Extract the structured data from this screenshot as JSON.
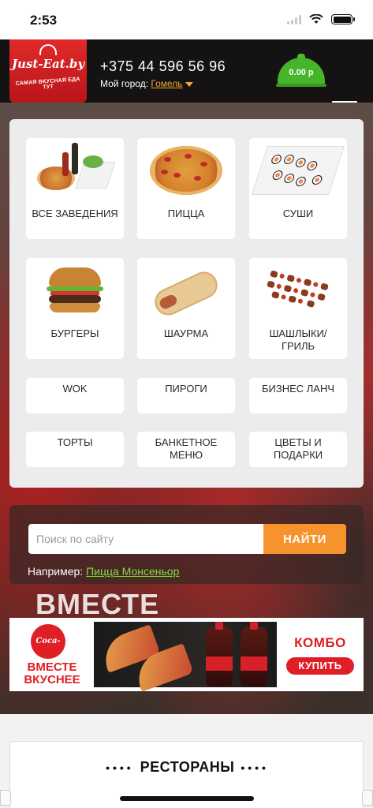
{
  "status_bar": {
    "time": "2:53"
  },
  "header": {
    "logo_name": "Just-Eat.by",
    "logo_tagline": "САМАЯ ВКУСНАЯ ЕДА ТУТ",
    "phone": "+375 44 596 56 96",
    "city_label": "Мой город:",
    "city_value": "Гомель",
    "cart_total": "0.00 р"
  },
  "categories": [
    {
      "label": "ВСЕ ЗАВЕДЕНИЯ",
      "icon": "all-restaurants-icon"
    },
    {
      "label": "ПИЦЦА",
      "icon": "pizza-icon"
    },
    {
      "label": "СУШИ",
      "icon": "sushi-icon"
    },
    {
      "label": "БУРГЕРЫ",
      "icon": "burger-icon"
    },
    {
      "label": "ШАУРМА",
      "icon": "shawarma-icon"
    },
    {
      "label": "ШАШЛЫКИ/ ГРИЛЬ",
      "icon": "grill-icon"
    },
    {
      "label": "WOK"
    },
    {
      "label": "ПИРОГИ"
    },
    {
      "label": "БИЗНЕС ЛАНЧ"
    },
    {
      "label": "ТОРТЫ"
    },
    {
      "label": "БАНКЕТНОЕ МЕНЮ"
    },
    {
      "label": "ЦВЕТЫ И ПОДАРКИ"
    }
  ],
  "search": {
    "placeholder": "Поиск по сайту",
    "button": "НАЙТИ",
    "example_label": "Например:",
    "example_link": "Пицца Монсеньор"
  },
  "background_text": "ВМЕСТЕ",
  "banner": {
    "brand": "Coca-Cola",
    "slogan_line1": "ВМЕСТЕ",
    "slogan_line2": "ВКУСНЕЕ",
    "combo": "КОМБО",
    "buy": "КУПИТЬ"
  },
  "restaurants": {
    "title": "РЕСТОРАНЫ"
  },
  "colors": {
    "accent_orange": "#f7932d",
    "brand_red": "#e01e25",
    "cart_green": "#46b52a",
    "link_green": "#7ddd3a"
  }
}
